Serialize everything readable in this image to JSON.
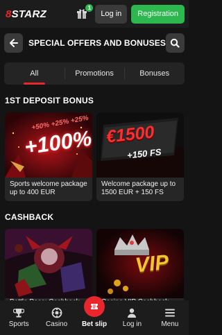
{
  "header": {
    "logo_prefix": "8",
    "logo_text": "STARZ",
    "gift_badge": "1",
    "login_label": "Log in",
    "register_label": "Registration"
  },
  "titlebar": {
    "title": "SPECIAL OFFERS AND BONUSES"
  },
  "tabs": [
    {
      "label": "All",
      "active": true
    },
    {
      "label": "Promotions",
      "active": false
    },
    {
      "label": "Bonuses",
      "active": false
    }
  ],
  "sections": {
    "deposit": {
      "title": "1ST DEPOSIT BONUS",
      "cards": [
        {
          "art_text": "+100%",
          "art_small": "+50% +25% +25%",
          "caption": "Sports welcome package up to 400 EUR"
        },
        {
          "art_text": "€1500",
          "art_small": "+150 FS",
          "caption": "Welcome package up to 1500 EUR + 150 FS"
        }
      ]
    },
    "cashback": {
      "title": "CASHBACK",
      "cards": [
        {
          "art_text": "",
          "caption": "Battle Pass: Cashback"
        },
        {
          "art_text": "VIP",
          "caption": "Casino VIP Cashback"
        }
      ]
    }
  },
  "bottomnav": [
    {
      "label": "Sports",
      "icon": "trophy-icon"
    },
    {
      "label": "Casino",
      "icon": "chip-icon"
    },
    {
      "label": "Bet slip",
      "icon": "ticket-icon"
    },
    {
      "label": "Log in",
      "icon": "user-icon"
    },
    {
      "label": "Menu",
      "icon": "menu-icon"
    }
  ],
  "colors": {
    "accent": "#e8262b",
    "register": "#2cb84e",
    "background": "#141414"
  }
}
